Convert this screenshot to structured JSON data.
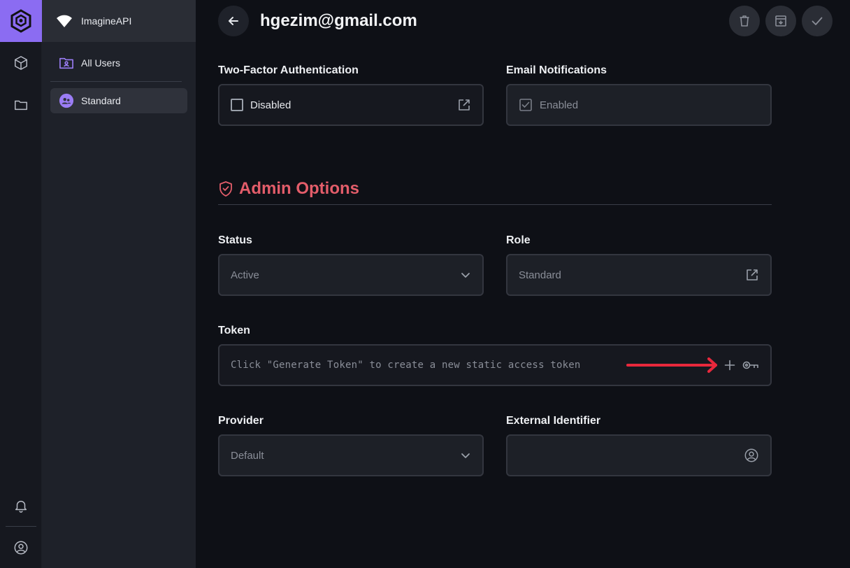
{
  "app": {
    "name": "ImagineAPI"
  },
  "rail": {
    "icons": [
      "logo-icon",
      "cube-icon",
      "folder-icon",
      "bell-icon",
      "user-circle-icon"
    ]
  },
  "nav": {
    "items": [
      {
        "label": "All Users",
        "icon": "user-folder-icon"
      },
      {
        "label": "Standard",
        "icon": "user-group-icon",
        "active": true
      }
    ]
  },
  "header": {
    "title": "hgezim@gmail.com",
    "actions": [
      "trash-icon",
      "archive-icon",
      "check-icon"
    ]
  },
  "fields": {
    "two_factor": {
      "label": "Two-Factor Authentication",
      "value": "Disabled",
      "checked": false
    },
    "email_notifications": {
      "label": "Email Notifications",
      "value": "Enabled",
      "checked": true
    },
    "status": {
      "label": "Status",
      "value": "Active"
    },
    "role": {
      "label": "Role",
      "value": "Standard"
    },
    "token": {
      "label": "Token",
      "placeholder": "Click \"Generate Token\" to create a new static access token"
    },
    "provider": {
      "label": "Provider",
      "value": "Default"
    },
    "external_identifier": {
      "label": "External Identifier",
      "value": ""
    }
  },
  "admin_section": {
    "title": "Admin Options"
  },
  "colors": {
    "accent": "#8b6cf2",
    "admin": "#e35d6a",
    "annotation_arrow": "#e8283c"
  }
}
